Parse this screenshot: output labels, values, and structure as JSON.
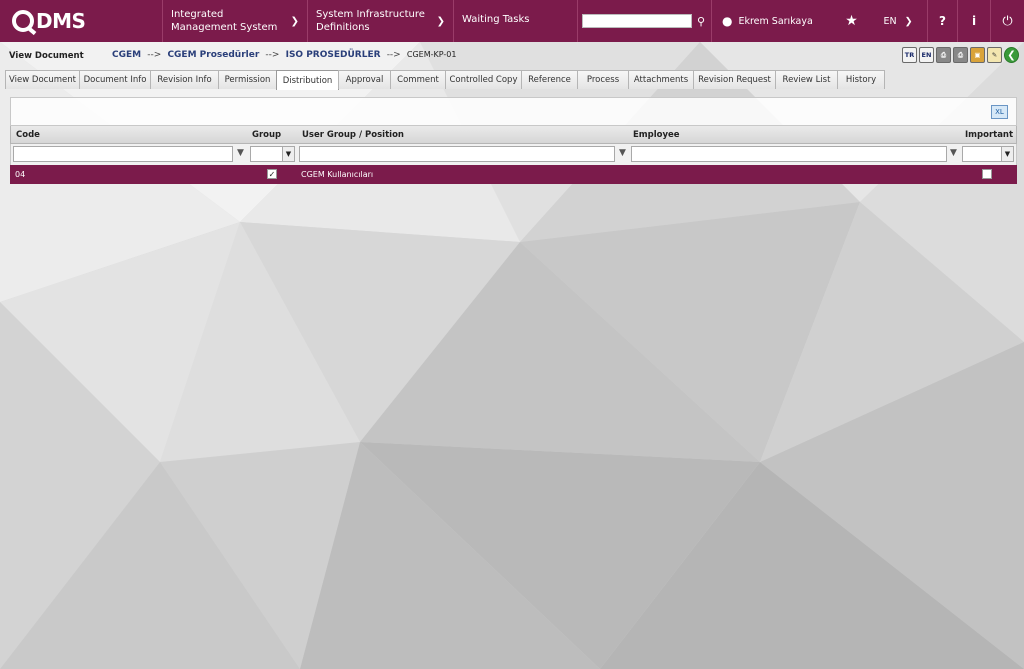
{
  "app": {
    "logo": "DMS",
    "menu": [
      {
        "label": "Integrated Management System"
      },
      {
        "label": "System Infrastructure Definitions"
      },
      {
        "label": "Waiting Tasks"
      }
    ],
    "search_value": "",
    "user_name": "Ekrem Sarıkaya",
    "language": "EN",
    "help_label": "?",
    "info_label": "i",
    "icons": {
      "search": "search-icon",
      "user": "user-icon",
      "favorite": "star-icon",
      "power": "power-icon"
    }
  },
  "breadcrumb": {
    "title": "View Document",
    "items": [
      "CGEM",
      "CGEM Prosedürler",
      "ISO PROSEDÜRLER"
    ],
    "current": "CGEM-KP-01",
    "arrow": "-->"
  },
  "toolbar": {
    "tr_label": "TR",
    "en_label": "EN"
  },
  "tabs": [
    {
      "label": "View Document"
    },
    {
      "label": "Document Info"
    },
    {
      "label": "Revision Info"
    },
    {
      "label": "Permission"
    },
    {
      "label": "Distribution",
      "active": true
    },
    {
      "label": "Approval"
    },
    {
      "label": "Comment"
    },
    {
      "label": "Controlled Copy"
    },
    {
      "label": "Reference"
    },
    {
      "label": "Process"
    },
    {
      "label": "Attachments"
    },
    {
      "label": "Revision Request"
    },
    {
      "label": "Review List"
    },
    {
      "label": "History"
    }
  ],
  "grid": {
    "columns": {
      "code": "Code",
      "group": "Group",
      "user_group": "User Group / Position",
      "employee": "Employee",
      "important": "Important"
    },
    "rows": [
      {
        "code": "04",
        "group": true,
        "user_group": "CGEM Kullanıcıları",
        "employee": "",
        "important": false
      }
    ]
  },
  "colors": {
    "brand": "#7b1b4b"
  }
}
